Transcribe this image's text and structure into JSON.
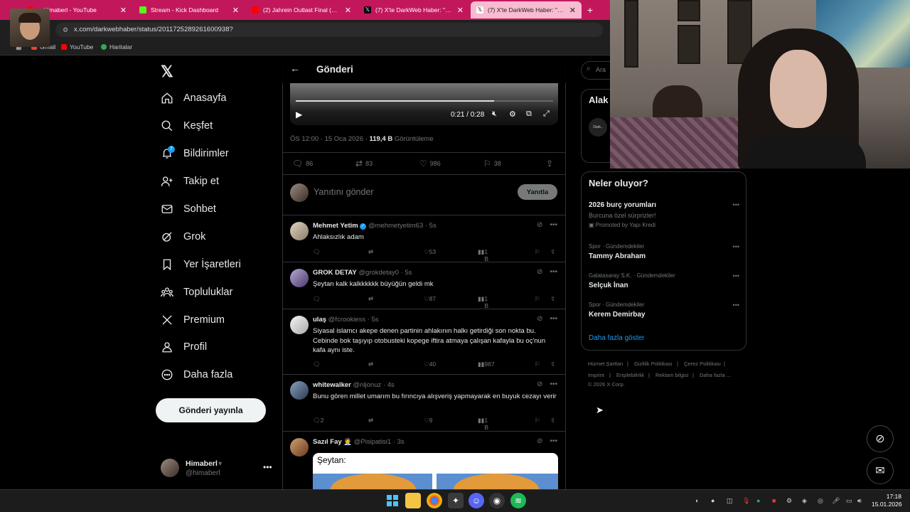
{
  "browser": {
    "tabs": [
      {
        "title": "...Himaberl - YouTube",
        "color": "#ff0000"
      },
      {
        "title": "Stream - Kick Dashboard",
        "color": "#53fc18"
      },
      {
        "title": "(2) Jahrein Outlast Final (Oyunu",
        "color": "#ff0000"
      },
      {
        "title": "(7) X'te DarkWeb Haber: \"Eskişe",
        "color": "#000000"
      },
      {
        "title": "(7) X'te DarkWeb Haber: \"Eskişe",
        "color": "#000000"
      }
    ],
    "url": "x.com/darkwebhaber/status/2011725289261600938?",
    "bookmarks": [
      "Gmail",
      "YouTube",
      "Haritalar"
    ]
  },
  "nav": {
    "items": [
      "Anasayfa",
      "Keşfet",
      "Bildirimler",
      "Takip et",
      "Sohbet",
      "Grok",
      "Yer İşaretleri",
      "Topluluklar",
      "Premium",
      "Profil",
      "Daha fazla"
    ],
    "icons": [
      "home-icon",
      "search-icon",
      "bell-icon",
      "person-add-icon",
      "mail-icon",
      "grok-icon",
      "bookmark-icon",
      "communities-icon",
      "x-icon",
      "profile-icon",
      "more-circle-icon"
    ],
    "notif_count": "7",
    "post_button": "Gönderi yayınla",
    "me": {
      "name": "Himaberl♆",
      "handle": "@himaberl"
    }
  },
  "header": {
    "title": "Gönderi"
  },
  "video": {
    "time": "0:21 / 0:28",
    "progress": 0.77
  },
  "tweet_meta": {
    "time": "ÖS 12:00 · 15 Oca 2026 · ",
    "views": "119,4 B",
    "views_label": " Görüntüleme"
  },
  "stats": {
    "replies": "86",
    "reposts": "83",
    "likes": "986",
    "bookmarks": "38"
  },
  "reply": {
    "placeholder": "Yanıtını gönder",
    "button": "Yanıtla"
  },
  "posts": [
    {
      "name": "Mehmet Yetim",
      "verified": true,
      "handle": "@mehmetyetim63 · 5s",
      "text": "Ahlaksızlık adam",
      "replies": "",
      "likes": "53",
      "views": "1 B"
    },
    {
      "name": "GROK DETAY",
      "verified": false,
      "handle": "@grokdetay0 · 5s",
      "text": "Şeytan kalk kalkkkkkk büyüğün geldi mk",
      "replies": "",
      "likes": "87",
      "views": "1 B"
    },
    {
      "name": "ulaş",
      "verified": false,
      "handle": "@fcrookiess · 5s",
      "text": "Siyasal islamcı akepe denen partinin ahlakının halkı getirdiği son nokta bu. Cebinde bok taşıyıp otobusteki kopege iftira atmaya çalışan kafayla bu oç'nun kafa aynı iste.",
      "replies": "",
      "likes": "40",
      "views": "987"
    },
    {
      "name": "whitewalker",
      "verified": false,
      "handle": "@nljonuz · 4s",
      "text": "Bunu gören millet umarım bu fırıncıya alışveriş yapmayarak en buyuk cezayı verir",
      "replies": "2",
      "likes": "9",
      "views": "1 B"
    },
    {
      "name": "Sazıl Fay 🧑‍💼",
      "verified": false,
      "handle": "@Pisipatisi1 · 3s",
      "text": "",
      "replies": "",
      "likes": "",
      "views": ""
    }
  ],
  "meme": {
    "title": "Şeytan:"
  },
  "right": {
    "search_placeholder": "Ara",
    "related_title": "Alak",
    "related_avatar": "Dark..",
    "trends_title": "Neler oluyor?",
    "trends": [
      {
        "category": "",
        "name": "2026 burç yorumları",
        "sub": "Burcuna özel sürprizler!",
        "promo": "Promoted by Yapı Kredi"
      },
      {
        "category": "Spor · Gündemdekiler",
        "name": "Tammy Abraham",
        "sub": "",
        "promo": ""
      },
      {
        "category": "Galatasaray S.K. · Gündemdekiler",
        "name": "Selçuk İnan",
        "sub": "",
        "promo": ""
      },
      {
        "category": "Spor · Gündemdekiler",
        "name": "Kerem Demirbay",
        "sub": "",
        "promo": ""
      }
    ],
    "show_more": "Daha fazla göster",
    "footer": [
      "Hizmet Şartları",
      "|",
      "Gizlilik Politikası",
      "|",
      "Çerez Politikası",
      "|",
      "Imprint",
      "|",
      "Erişilebilirlik",
      "|",
      "Reklam bilgisi",
      "|",
      "Daha fazla ...",
      "© 2026 X Corp."
    ]
  },
  "clock": {
    "time": "17:18",
    "date": "15.01.2026"
  }
}
